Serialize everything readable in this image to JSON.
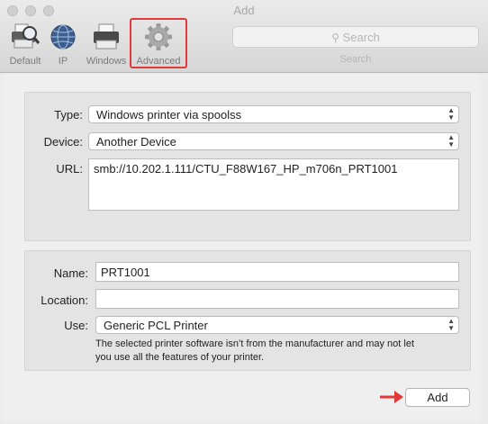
{
  "window": {
    "title": "Add"
  },
  "toolbar": {
    "items": [
      {
        "label": "Default",
        "icon": "default-printer-icon"
      },
      {
        "label": "IP",
        "icon": "globe-icon"
      },
      {
        "label": "Windows",
        "icon": "windows-printer-icon"
      },
      {
        "label": "Advanced",
        "icon": "gear-icon"
      }
    ],
    "selected": "Advanced",
    "highlight_color": "#e23a3a"
  },
  "search": {
    "placeholder": "Search",
    "caption": "Search"
  },
  "connection": {
    "type_label": "Type:",
    "type_value": "Windows printer via spoolss",
    "device_label": "Device:",
    "device_value": "Another Device",
    "url_label": "URL:",
    "url_value": "smb://10.202.1.111/CTU_F88W167_HP_m706n_PRT1001"
  },
  "printer": {
    "name_label": "Name:",
    "name_value": "PRT1001",
    "location_label": "Location:",
    "location_value": "",
    "use_label": "Use:",
    "use_value": "Generic PCL Printer",
    "warning_line1": "The selected printer software isn’t from the manufacturer and may not let",
    "warning_line2": "you use all the features of your printer."
  },
  "footer": {
    "add_label": "Add",
    "arrow_color": "#e23a3a"
  }
}
